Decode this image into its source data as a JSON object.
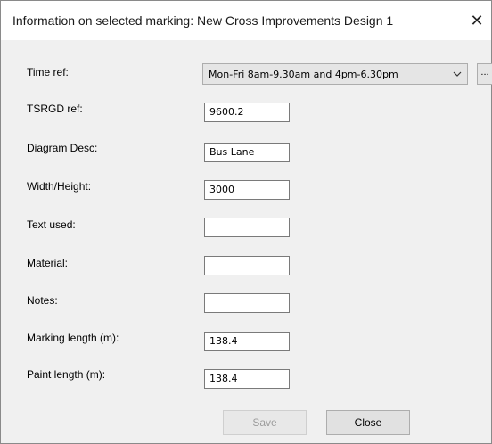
{
  "window": {
    "title": "Information on selected marking: New Cross Improvements Design 1",
    "close_glyph": "✕"
  },
  "fields": {
    "time_ref": {
      "label": "Time ref:",
      "value": "Mon-Fri 8am-9.30am and 4pm-6.30pm",
      "more_label": "..."
    },
    "tsrgd_ref": {
      "label": "TSRGD ref:",
      "value": "9600.2"
    },
    "diagram_desc": {
      "label": "Diagram Desc:",
      "value": "Bus Lane"
    },
    "width_height": {
      "label": "Width/Height:",
      "value": "3000"
    },
    "text_used": {
      "label": "Text used:",
      "value": ""
    },
    "material": {
      "label": "Material:",
      "value": ""
    },
    "notes": {
      "label": "Notes:",
      "value": ""
    },
    "marking_length": {
      "label": "Marking length (m):",
      "value": "138.4"
    },
    "paint_length": {
      "label": "Paint length (m):",
      "value": "138.4"
    }
  },
  "buttons": {
    "save": {
      "label": "Save",
      "enabled": false
    },
    "close": {
      "label": "Close",
      "enabled": true
    }
  },
  "icons": {
    "dropdown": "chevron-down-icon",
    "window_close": "close-icon"
  }
}
